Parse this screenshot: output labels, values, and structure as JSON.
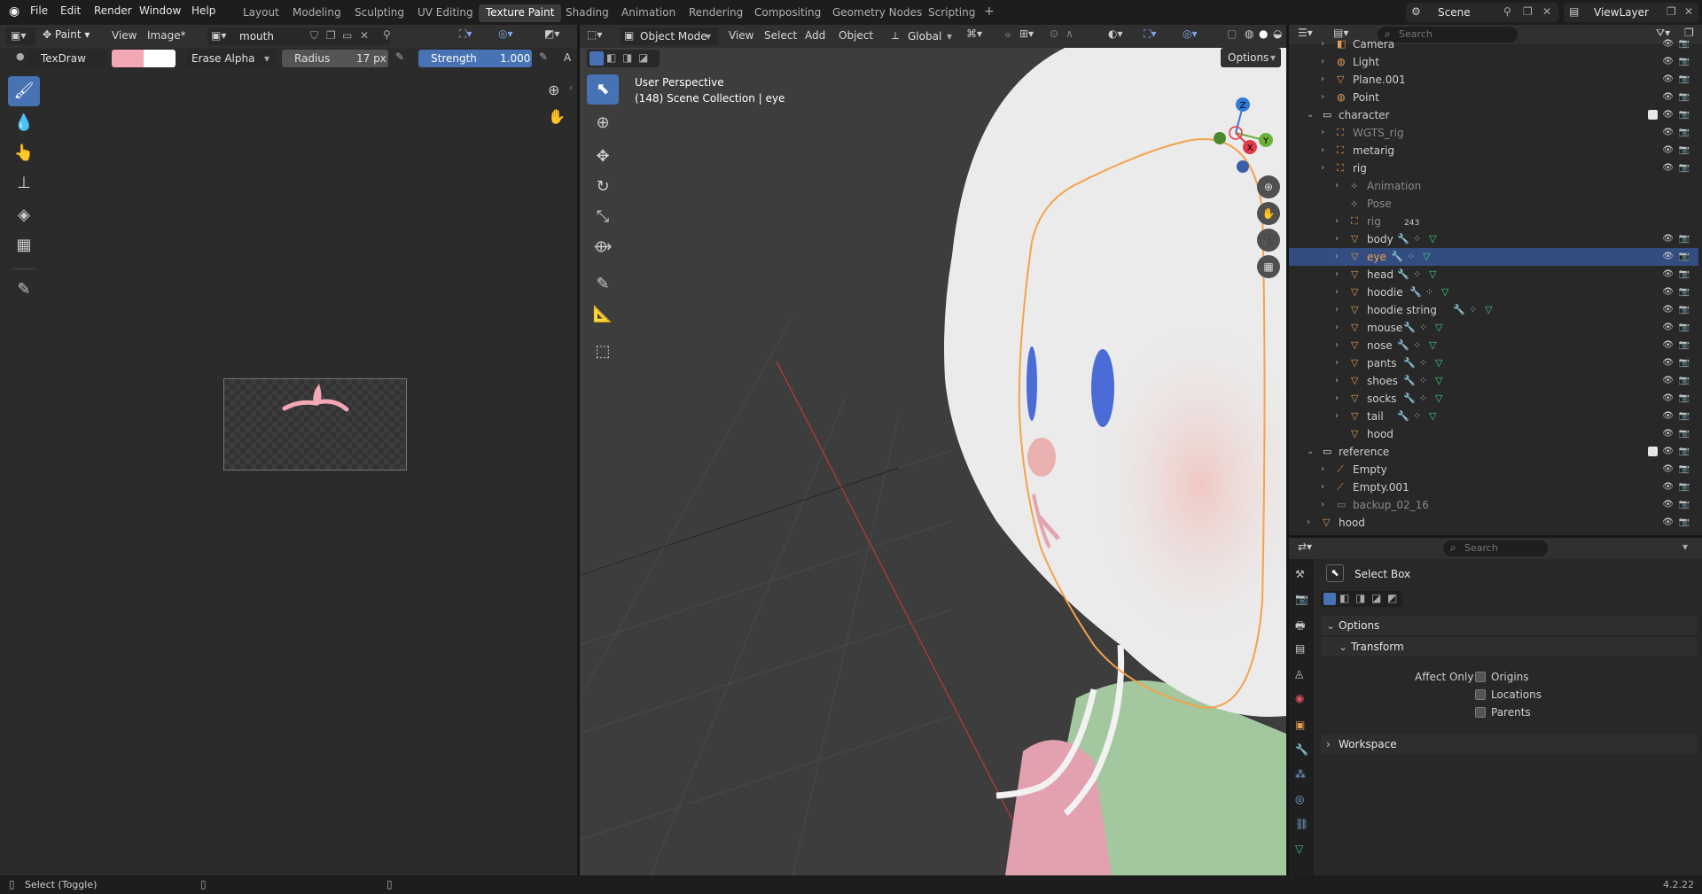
{
  "menu": {
    "file": "File",
    "edit": "Edit",
    "render": "Render",
    "window": "Window",
    "help": "Help"
  },
  "workspaces": [
    "Layout",
    "Modeling",
    "Sculpting",
    "UV Editing",
    "Texture Paint",
    "Shading",
    "Animation",
    "Rendering",
    "Compositing",
    "Geometry Nodes",
    "Scripting"
  ],
  "active_workspace": "Texture Paint",
  "scene": "Scene",
  "view_layer": "ViewLayer",
  "image_editor": {
    "mode": "Paint",
    "view": "View",
    "image_menu": "Image*",
    "image_name": "mouth",
    "brush": "TexDraw",
    "blend": "Erase Alpha",
    "radius_label": "Radius",
    "radius_value": "17 px",
    "strength_label": "Strength",
    "strength_value": "1.000",
    "extra": "A",
    "color_primary": "#f4a7b4",
    "color_secondary": "#ffffff"
  },
  "viewport": {
    "mode": "Object Mode",
    "view": "View",
    "select": "Select",
    "add": "Add",
    "object": "Object",
    "orientation": "Global",
    "options": "Options",
    "perspective": "User Perspective",
    "collection_info": "(148) Scene Collection | eye",
    "gizmo": {
      "z": "Z",
      "y": "Y",
      "x": "X"
    }
  },
  "outliner": {
    "search_placeholder": "Search",
    "rows": [
      {
        "label": "Camera",
        "indent": 1
      },
      {
        "label": "Light",
        "indent": 1
      },
      {
        "label": "Plane.001",
        "indent": 1
      },
      {
        "label": "Point",
        "indent": 1
      },
      {
        "label": "character",
        "indent": 0
      },
      {
        "label": "WGTS_rig",
        "indent": 1
      },
      {
        "label": "metarig",
        "indent": 1
      },
      {
        "label": "rig",
        "indent": 1
      },
      {
        "label": "Animation",
        "indent": 2
      },
      {
        "label": "Pose",
        "indent": 2
      },
      {
        "label": "rig",
        "indent": 2
      },
      {
        "label": "body",
        "indent": 2
      },
      {
        "label": "eye",
        "indent": 2
      },
      {
        "label": "head",
        "indent": 2
      },
      {
        "label": "hoodie",
        "indent": 2
      },
      {
        "label": "hoodie string",
        "indent": 2
      },
      {
        "label": "mouse",
        "indent": 2
      },
      {
        "label": "nose",
        "indent": 2
      },
      {
        "label": "pants",
        "indent": 2
      },
      {
        "label": "shoes",
        "indent": 2
      },
      {
        "label": "socks",
        "indent": 2
      },
      {
        "label": "tail",
        "indent": 2
      },
      {
        "label": "hood",
        "indent": 2
      },
      {
        "label": "reference",
        "indent": 0
      },
      {
        "label": "Empty",
        "indent": 1
      },
      {
        "label": "Empty.001",
        "indent": 1
      },
      {
        "label": "backup_02_16",
        "indent": 1
      },
      {
        "label": "hood",
        "indent": 0
      }
    ],
    "rig_count": "243",
    "selected": "eye"
  },
  "properties": {
    "search_placeholder": "Search",
    "tool": "Select Box",
    "options": "Options",
    "transform": "Transform",
    "affect_only": "Affect Only",
    "origins": "Origins",
    "locations": "Locations",
    "parents": "Parents",
    "workspace": "Workspace"
  },
  "status": {
    "left": "Select (Toggle)",
    "version": "4.2.22"
  }
}
